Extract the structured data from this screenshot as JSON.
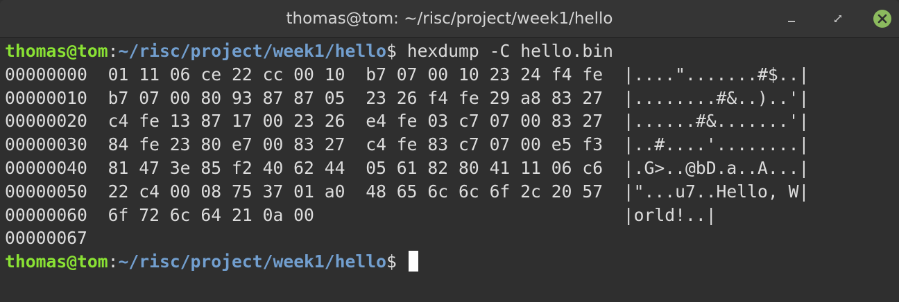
{
  "window": {
    "title": "thomas@tom: ~/risc/project/week1/hello"
  },
  "controls": {
    "minimize_icon": "minimize-icon",
    "maximize_icon": "maximize-icon",
    "close_icon": "close-icon",
    "close_color": "#8cbb5e"
  },
  "colors": {
    "prompt_user": "#8ae234",
    "prompt_path": "#729fcf",
    "text": "#dcdcdc",
    "background": "#2f2f2f"
  },
  "terminal": {
    "prompt1": {
      "user": "thomas@tom",
      "colon": ":",
      "path": "~/risc/project/week1/hello",
      "dollar": "$",
      "command": " hexdump -C hello.bin"
    },
    "output": [
      "00000000  01 11 06 ce 22 cc 00 10  b7 07 00 10 23 24 f4 fe  |....\".......#$..|",
      "00000010  b7 07 00 80 93 87 87 05  23 26 f4 fe 29 a8 83 27  |........#&..)..'|",
      "00000020  c4 fe 13 87 17 00 23 26  e4 fe 03 c7 07 00 83 27  |......#&.......'|",
      "00000030  84 fe 23 80 e7 00 83 27  c4 fe 83 c7 07 00 e5 f3  |..#....'........|",
      "00000040  81 47 3e 85 f2 40 62 44  05 61 82 80 41 11 06 c6  |.G>..@bD.a..A...|",
      "00000050  22 c4 00 08 75 37 01 a0  48 65 6c 6c 6f 2c 20 57  |\"...u7..Hello, W|",
      "00000060  6f 72 6c 64 21 0a 00                              |orld!..|",
      "00000067"
    ],
    "prompt2": {
      "user": "thomas@tom",
      "colon": ":",
      "path": "~/risc/project/week1/hello",
      "dollar": "$",
      "command": " "
    }
  }
}
